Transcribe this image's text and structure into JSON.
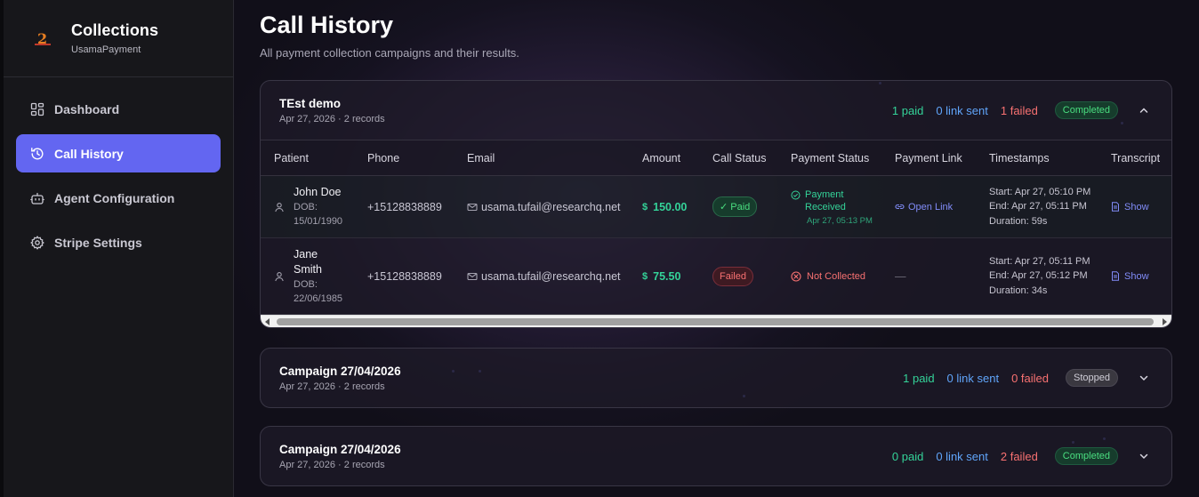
{
  "sidebar": {
    "brand_title": "Collections",
    "brand_sub": "UsamaPayment",
    "items": [
      {
        "label": "Dashboard",
        "icon": "grid-icon",
        "active": false
      },
      {
        "label": "Call History",
        "icon": "history-icon",
        "active": true
      },
      {
        "label": "Agent Configuration",
        "icon": "bot-icon",
        "active": false
      },
      {
        "label": "Stripe Settings",
        "icon": "gear-icon",
        "active": false
      }
    ]
  },
  "header": {
    "title": "Call History",
    "subtitle": "All payment collection campaigns and their results."
  },
  "table_headers": [
    "Patient",
    "Phone",
    "Email",
    "Amount",
    "Call Status",
    "Payment Status",
    "Payment Link",
    "Timestamps",
    "Transcript"
  ],
  "campaigns": [
    {
      "name": "TEst demo",
      "meta": "Apr 27, 2026 · 2 records",
      "paid": "1 paid",
      "link_sent": "0 link sent",
      "failed": "1 failed",
      "status": "Completed",
      "expanded": true,
      "rows": [
        {
          "name": "John Doe",
          "dob": "DOB: 15/01/1990",
          "phone": "+15128838889",
          "email": "usama.tufail@researchq.net",
          "amount": "150.00",
          "currency": "$",
          "call_status": "✓ Paid",
          "payment_status": "Payment Received",
          "payment_time": "Apr 27, 05:13 PM",
          "payment_link": "Open Link",
          "start": "Start: Apr 27, 05:10 PM",
          "end": "End: Apr 27, 05:11 PM",
          "duration": "Duration: 59s",
          "transcript": "Show"
        },
        {
          "name": "Jane Smith",
          "dob": "DOB: 22/06/1985",
          "phone": "+15128838889",
          "email": "usama.tufail@researchq.net",
          "amount": "75.50",
          "currency": "$",
          "call_status": "Failed",
          "payment_status": "Not Collected",
          "payment_link": "—",
          "start": "Start: Apr 27, 05:11 PM",
          "end": "End: Apr 27, 05:12 PM",
          "duration": "Duration: 34s",
          "transcript": "Show"
        }
      ]
    },
    {
      "name": "Campaign 27/04/2026",
      "meta": "Apr 27, 2026 · 2 records",
      "paid": "1 paid",
      "link_sent": "0 link sent",
      "failed": "0 failed",
      "status": "Stopped",
      "expanded": false
    },
    {
      "name": "Campaign 27/04/2026",
      "meta": "Apr 27, 2026 · 2 records",
      "paid": "0 paid",
      "link_sent": "0 link sent",
      "failed": "2 failed",
      "status": "Completed",
      "expanded": false
    }
  ],
  "colors": {
    "accent": "#6366f1",
    "paid": "#34d399",
    "link": "#60a5fa",
    "failed": "#f87171"
  }
}
